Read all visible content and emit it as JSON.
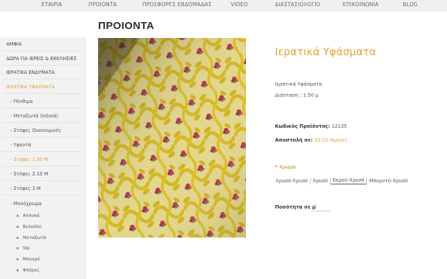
{
  "nav": {
    "items": [
      "ΕΤΑΙΡΙΑ",
      "ΠΡΟΙΟΝΤΑ",
      "ΠΡΟΣΦΟΡΕΣ ΕΒΔΟΜΑΔΑΣ",
      "VIDEO",
      "ΔΙΑΣΤΑΣΙΟΛΟΓΙΟ",
      "ΕΠΙΚΟΙΝΩΝΙΑ",
      "BLOG"
    ]
  },
  "page": {
    "title": "ΠΡΟΙΟΝΤΑ"
  },
  "sidebar": {
    "top_items": [
      "ΑΜΦΙΑ",
      "ΔΩΡΑ ΓΙΑ ΙΕΡΕΙΣ & ΕΚΚΛΗΣΙΕΣ",
      "ΙΕΡΑΤΙΚΑ ΕΝΔΥΜΑΤΑ",
      "ΙΕΡΑΤΙΚΑ ΥΦΑΣΜΑΤΑ"
    ],
    "sub_items": [
      "- Πένθιμα",
      "- Μεταξωτά (Ινδικά)",
      "- Στόφες Οικονομικές",
      "- Υφαντά",
      "- Στόφες 1.50 Μ",
      "- Στόφες 2.10 Μ",
      "- Στόφες 3 Μ",
      "- Μονόχρωμα"
    ],
    "sub2_items": [
      "Αλπακά",
      "Βελούδο",
      "Μεταξωτά",
      "Sip",
      "Μουαρέ",
      "Φόδρες"
    ]
  },
  "product": {
    "title": "Ιερατικά Υφάσματα",
    "category": "Ιερατικά Υφάσματα",
    "dimension": "Διάσταση : 1.50 μ",
    "code_label": "Κωδικός Προϊόντος:",
    "code_value": "12135",
    "shipping_label": "Αποστολή σε:",
    "shipping_value": "20-25 Ημέρες",
    "color_required_mark": "*",
    "color_label": "Χρώμα",
    "color_options": [
      "Χρυσό-Χρυσό",
      "Χρυσό",
      "Εκρού-Χρυσό",
      "Μπορντό-Χρυσό"
    ],
    "selected_color_index": 2,
    "quantity_label": "Ποσότητα σε μ",
    "quantity_value": "1"
  },
  "colors": {
    "accent": "#e3a23a",
    "fabric_base": "#e6d98e",
    "fabric_gold": "#d8c02a",
    "rose": "#b5354a"
  }
}
